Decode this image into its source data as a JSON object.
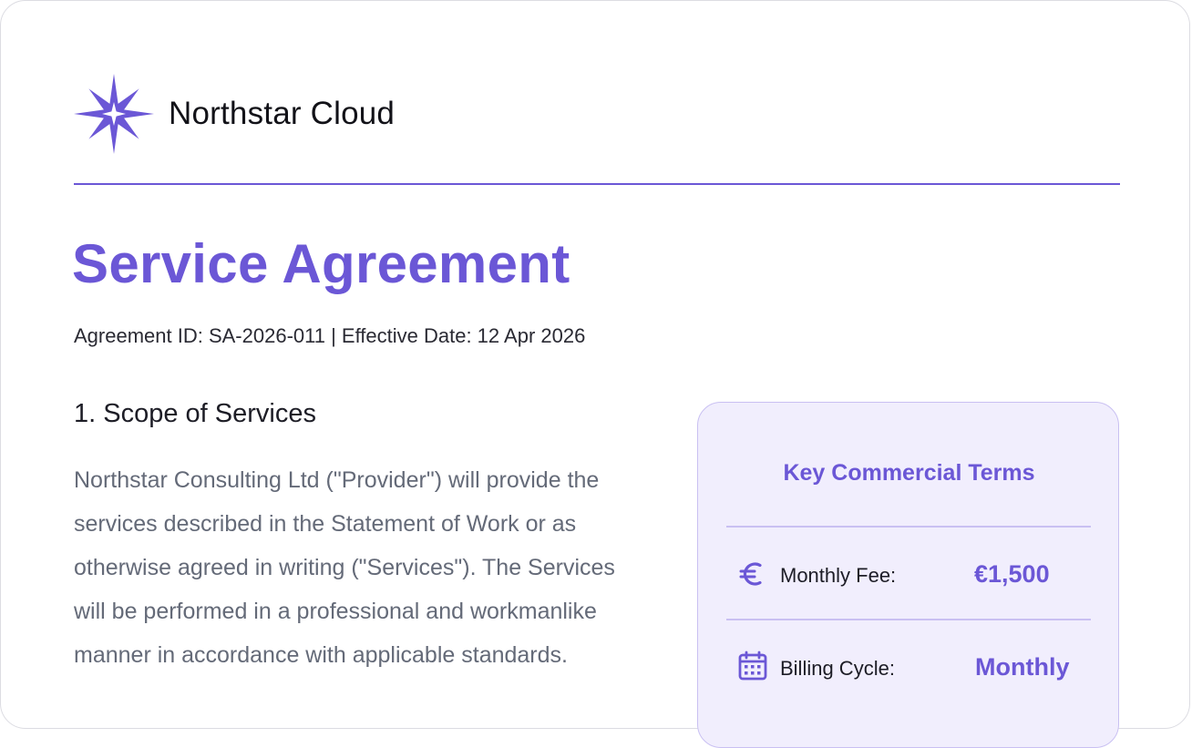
{
  "brand": {
    "name": "Northstar Cloud",
    "logo_icon": "north-star-icon",
    "accent_color": "#6b57d6"
  },
  "document": {
    "title": "Service Agreement",
    "meta": "Agreement ID: SA-2026-011 | Effective Date: 12 Apr 2026"
  },
  "section": {
    "heading": "1. Scope of Services",
    "body": "Northstar Consulting Ltd (\"Provider\") will provide the services described in the Statement of Work or as otherwise agreed in writing (\"Services\"). The Services will be performed in a professional and workmanlike manner in accordance with applicable standards."
  },
  "terms_card": {
    "title": "Key Commercial Terms",
    "rows": [
      {
        "icon": "euro-icon",
        "label": "Monthly Fee:",
        "value": "€1,500"
      },
      {
        "icon": "calendar-icon",
        "label": "Billing Cycle:",
        "value": "Monthly"
      }
    ]
  }
}
